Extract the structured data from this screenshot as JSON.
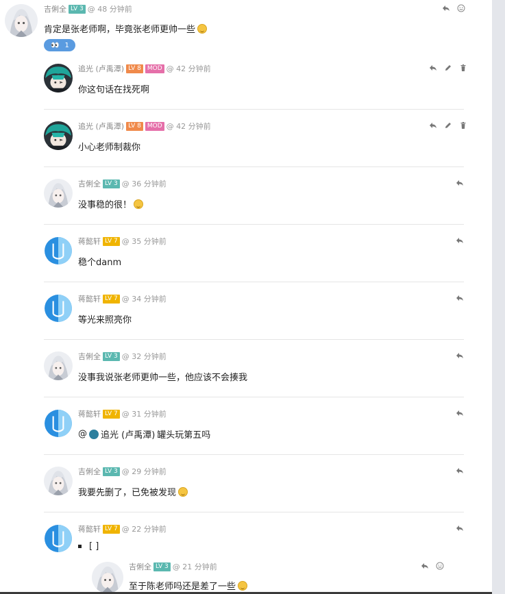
{
  "comments": [
    {
      "name": "吉俐全",
      "level": "LV 3",
      "time": "@ 48 分钟前",
      "text": "肯定是张老师啊，毕竟张老师更帅一些"
    },
    {
      "name": "追光 (卢禹潭)",
      "level": "LV 8",
      "role": "MOD",
      "time": "@ 42 分钟前",
      "text": "你这句话在找死啊"
    },
    {
      "name": "追光 (卢禹潭)",
      "level": "LV 8",
      "role": "MOD",
      "time": "@ 42 分钟前",
      "text": "小心老师制裁你"
    },
    {
      "name": "吉俐全",
      "level": "LV 3",
      "time": "@ 36 分钟前",
      "text": "没事稳的很！"
    },
    {
      "name": "蒋懿轩",
      "level": "LV 7",
      "time": "@ 35 分钟前",
      "text": "稳个danm"
    },
    {
      "name": "蒋懿轩",
      "level": "LV 7",
      "time": "@ 34 分钟前",
      "text": "等光来照亮你"
    },
    {
      "name": "吉俐全",
      "level": "LV 3",
      "time": "@ 32 分钟前",
      "text": "没事我说张老师更帅一些，他应该不会揍我"
    },
    {
      "name": "蒋懿轩",
      "level": "LV 7",
      "time": "@ 31 分钟前",
      "mention_prefix": "@",
      "mention_name": "追光 (卢禹潭)",
      "text": "罐头玩第五吗"
    },
    {
      "name": "吉俐全",
      "level": "LV 3",
      "time": "@ 29 分钟前",
      "text": "我要先删了，已免被发现"
    },
    {
      "name": "蒋懿轩",
      "level": "LV 7",
      "time": "@ 22 分钟前",
      "text": "[ ]"
    },
    {
      "name": "吉俐全",
      "level": "LV 3",
      "time": "@ 21 分钟前",
      "text": "至于陈老师吗还是差了一些"
    }
  ],
  "reaction": {
    "emoji": "👀",
    "count": "1"
  },
  "icons": {
    "reply": "reply-icon",
    "emoji": "smile-icon",
    "edit": "pencil-icon",
    "delete": "trash-icon"
  },
  "colors": {
    "lv3": "#5bb8b0",
    "lv7": "#f0b400",
    "lv8": "#f08a4b",
    "mod": "#e56fa9",
    "reaction": "#5a9be0"
  }
}
